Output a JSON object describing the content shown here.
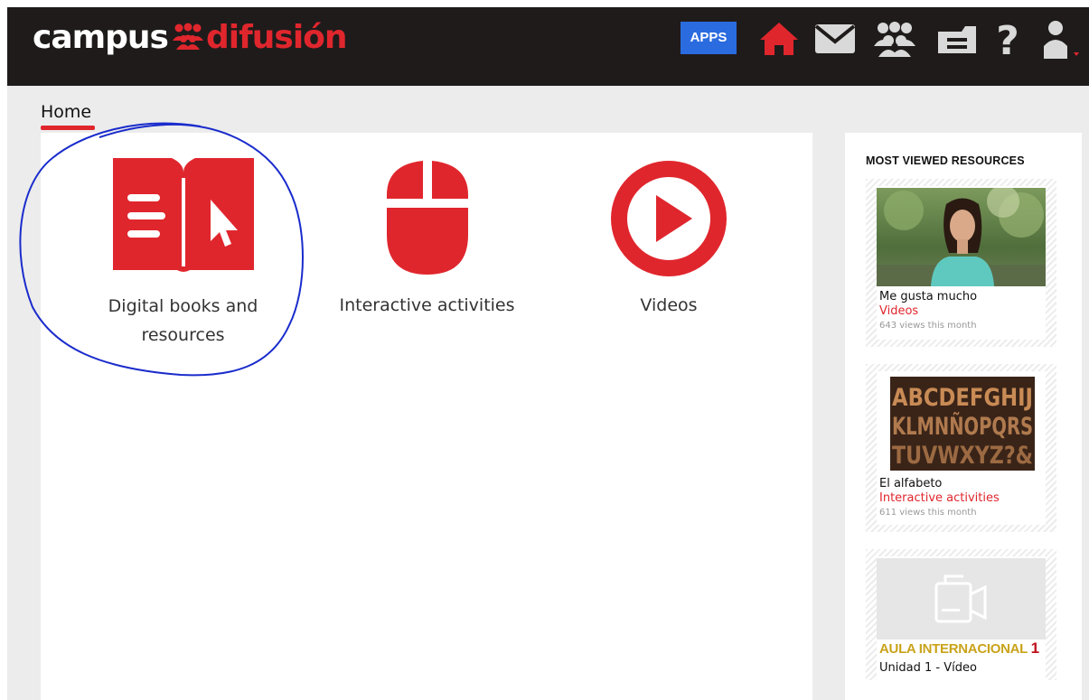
{
  "header": {
    "logo_part1": "campus",
    "logo_part2": "difusión",
    "apps_label": "APPS",
    "icons": [
      "home-icon",
      "mail-icon",
      "group-icon",
      "folder-icon",
      "help-icon",
      "user-icon"
    ]
  },
  "breadcrumb": {
    "label": "Home"
  },
  "tiles": [
    {
      "label_line1": "Digital books and",
      "label_line2": "resources",
      "icon": "digital-book-icon"
    },
    {
      "label": "Interactive activities",
      "icon": "mouse-icon"
    },
    {
      "label": "Videos",
      "icon": "play-icon"
    }
  ],
  "sidebar": {
    "title": "MOST VIEWED RESOURCES",
    "cards": [
      {
        "title": "Me gusta mucho",
        "category": "Videos",
        "views": "643 views this month",
        "thumb": "woman-photo"
      },
      {
        "title": "El alfabeto",
        "category": "Interactive activities",
        "views": "611 views this month",
        "thumb": "alphabet-letters",
        "thumb_text": [
          "ABCDEFGHIJ",
          "KLMNÑOPQRS",
          "TUVWXYZ?&"
        ]
      },
      {
        "title": "Unidad 1 - Vídeo",
        "thumb": "video-camera-icon",
        "brand_text": "AULA INTERNACIONAL",
        "brand_number": "1"
      }
    ]
  },
  "colors": {
    "brand_red": "#e0262d",
    "header_bg": "#1f1b1b",
    "apps_blue": "#2a6be0",
    "annotation_blue": "#1a2ccc"
  }
}
